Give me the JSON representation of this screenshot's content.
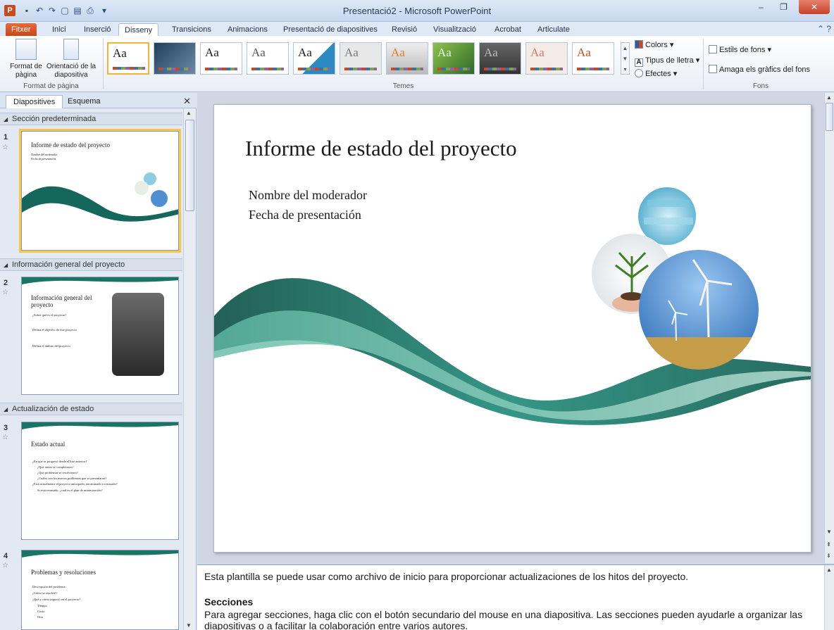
{
  "window": {
    "title": "Presentació2 - Microsoft PowerPoint",
    "minimize": "–",
    "restore": "❐",
    "close": "✕"
  },
  "tabs": [
    {
      "label": "Fitxer"
    },
    {
      "label": "Inici"
    },
    {
      "label": "Inserció"
    },
    {
      "label": "Disseny"
    },
    {
      "label": "Transicions"
    },
    {
      "label": "Animacions"
    },
    {
      "label": "Presentació de diapositives"
    },
    {
      "label": "Revisió"
    },
    {
      "label": "Visualització"
    },
    {
      "label": "Acrobat"
    },
    {
      "label": "Articulate"
    }
  ],
  "active_tab": "Disseny",
  "ribbon": {
    "page_setup": {
      "format_label": "Format de pàgina",
      "orientation_label": "Orientació de la diapositiva",
      "group_label": "Format de pàgina"
    },
    "themes": {
      "group_label": "Temes",
      "sample_text": "Aa",
      "count": 12
    },
    "theme_options": {
      "colors": "Colors",
      "fonts": "Tipus de lletra",
      "effects": "Efectes"
    },
    "background": {
      "styles": "Estils de fons",
      "hide_graphics": "Amaga els gràfics del fons",
      "group_label": "Fons"
    }
  },
  "left_pane": {
    "tabs": [
      "Diapositives",
      "Esquema"
    ],
    "sections": [
      {
        "name": "Sección predeterminada"
      },
      {
        "name": "Información general del proyecto"
      },
      {
        "name": "Actualización de estado"
      }
    ],
    "slides": [
      {
        "number": "1",
        "title": "Informe de estado del proyecto",
        "bullets": [
          "Nombre del moderador",
          "Fecha de presentación"
        ]
      },
      {
        "number": "2",
        "title": "Información general del proyecto",
        "bullets": [
          "¿Sobre qué es el proyecto?",
          "Defina el objetivo de este proyecto",
          "Defina el ámbito del proyecto"
        ]
      },
      {
        "number": "3",
        "title": "Estado actual",
        "bullets": [
          "¿En qué se progresó desde el hito anterior?",
          "¿Qué tareas se completaron?",
          "¿Qué problemas se resolvieron?",
          "¿Cuáles son los nuevos problemas que se presentaron?",
          "¿Está actualmente el proyecto anticipado, encaminado o retrasado?",
          "Si está retrasado, ¿cuál es el plan de minimización?"
        ]
      },
      {
        "number": "4",
        "title": "Problemas y resoluciones",
        "bullets": [
          "Descripción del problema",
          "¿Cómo se resolvió?",
          "¿Qué y cómo impactó en el proyecto?",
          "Tiempo",
          "Costo",
          "Otro"
        ]
      }
    ]
  },
  "slide": {
    "title": "Informe de estado del proyecto",
    "subtitle_line1": "Nombre del moderador",
    "subtitle_line2": "Fecha de presentación"
  },
  "notes": {
    "intro": "Esta plantilla se puede usar como archivo de inicio para proporcionar actualizaciones de los hitos del proyecto.",
    "heading": "Secciones",
    "body": "Para agregar secciones, haga clic con el botón secundario del mouse en una diapositiva. Las secciones pueden ayudarle a organizar las diapositivas o a facilitar la colaboración entre varios autores."
  },
  "colors": {
    "file_tab": "#c7461a",
    "selection": "#f5c84c",
    "wave_dark": "#0e5a4e",
    "wave_light": "#3aa08a"
  }
}
